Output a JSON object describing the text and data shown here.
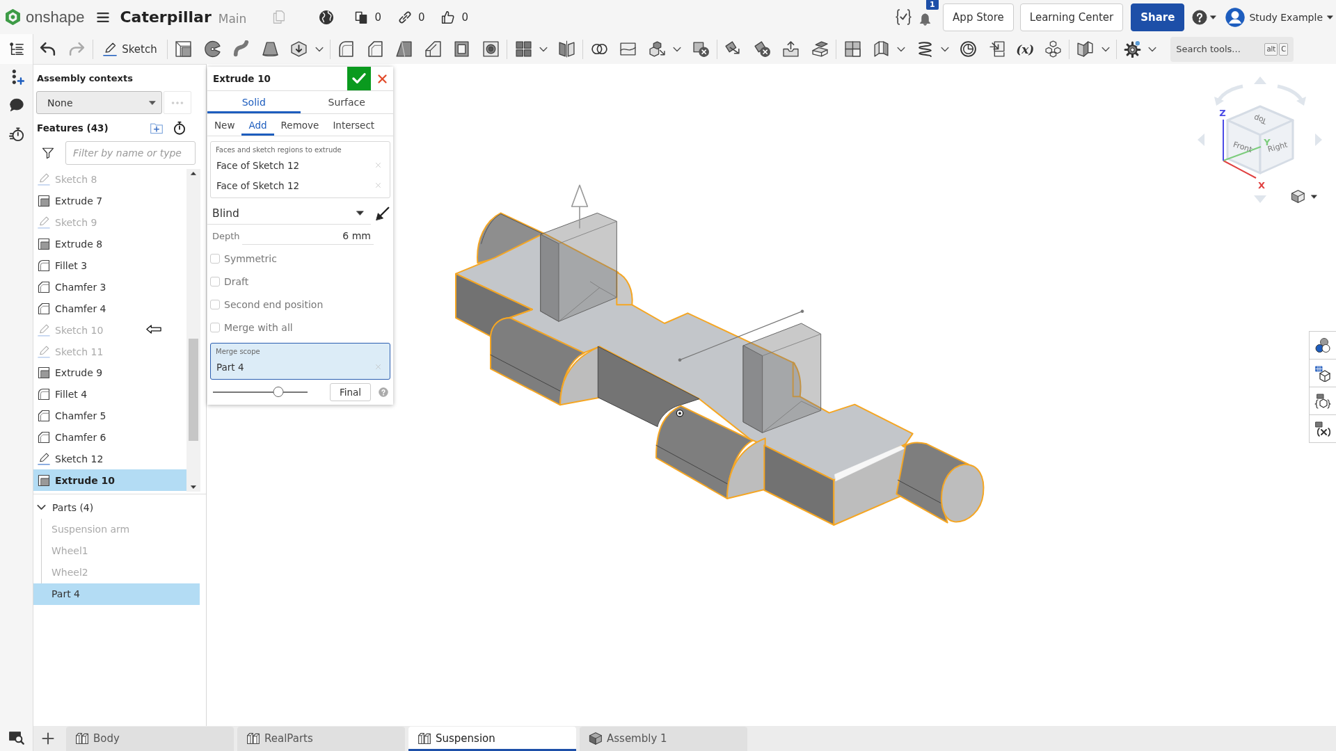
{
  "top_bar": {
    "logo_text": "onshape",
    "document_title": "Caterpillar",
    "workspace": "Main",
    "counters": [
      {
        "kind": "versions",
        "value": "0"
      },
      {
        "kind": "links",
        "value": "0"
      },
      {
        "kind": "likes",
        "value": "0"
      }
    ],
    "notifications": "1",
    "buttons": [
      {
        "label": "App Store",
        "kind": "outline"
      },
      {
        "label": "Learning Center",
        "kind": "outline"
      },
      {
        "label": "Share",
        "kind": "primary"
      }
    ],
    "user_name": "Study Example"
  },
  "toolbar": {
    "sketch_label": "Sketch",
    "variable_label": "(x)",
    "search": {
      "placeholder": "Search tools...",
      "keys": [
        "alt",
        "C"
      ]
    }
  },
  "left_panel": {
    "assembly_contexts": {
      "title": "Assembly contexts",
      "value": "None"
    },
    "features": {
      "title": "Features (43)",
      "filter_placeholder": "Filter by name or type",
      "items": [
        {
          "name": "Sketch 8",
          "kind": "sketch",
          "hidden": true,
          "selected": false
        },
        {
          "name": "Extrude 7",
          "kind": "extrude",
          "hidden": false,
          "selected": false
        },
        {
          "name": "Sketch 9",
          "kind": "sketch",
          "hidden": true,
          "selected": false
        },
        {
          "name": "Extrude 8",
          "kind": "extrude",
          "hidden": false,
          "selected": false
        },
        {
          "name": "Fillet 3",
          "kind": "fillet",
          "hidden": false,
          "selected": false
        },
        {
          "name": "Chamfer 3",
          "kind": "chamfer",
          "hidden": false,
          "selected": false
        },
        {
          "name": "Chamfer 4",
          "kind": "chamfer",
          "hidden": false,
          "selected": false
        },
        {
          "name": "Sketch 10",
          "kind": "sketch",
          "hidden": true,
          "selected": false
        },
        {
          "name": "Sketch 11",
          "kind": "sketch",
          "hidden": true,
          "selected": false
        },
        {
          "name": "Extrude 9",
          "kind": "extrude",
          "hidden": false,
          "selected": false
        },
        {
          "name": "Fillet 4",
          "kind": "fillet",
          "hidden": false,
          "selected": false
        },
        {
          "name": "Chamfer 5",
          "kind": "chamfer",
          "hidden": false,
          "selected": false
        },
        {
          "name": "Chamfer 6",
          "kind": "chamfer",
          "hidden": false,
          "selected": false
        },
        {
          "name": "Sketch 12",
          "kind": "sketch",
          "hidden": false,
          "selected": false
        },
        {
          "name": "Extrude 10",
          "kind": "extrude",
          "hidden": false,
          "selected": true
        }
      ]
    },
    "parts": {
      "title": "Parts (4)",
      "expanded": true,
      "children": [
        {
          "name": "Suspension arm",
          "hidden": true,
          "selected": false
        },
        {
          "name": "Wheel1",
          "hidden": true,
          "selected": false
        },
        {
          "name": "Wheel2",
          "hidden": true,
          "selected": false
        },
        {
          "name": "Part 4",
          "hidden": false,
          "selected": true
        }
      ]
    }
  },
  "feature_dialog": {
    "title": "Extrude 10",
    "body_tabs": [
      {
        "label": "Solid",
        "selected": true
      },
      {
        "label": "Surface",
        "selected": false
      }
    ],
    "operation_tabs": [
      {
        "label": "New",
        "selected": false
      },
      {
        "label": "Add",
        "selected": true
      },
      {
        "label": "Remove",
        "selected": false
      },
      {
        "label": "Intersect",
        "selected": false
      }
    ],
    "selection": {
      "label": "Faces and sketch regions to extrude",
      "items": [
        "Face of Sketch 12",
        "Face of Sketch 12"
      ]
    },
    "end_type": "Blind",
    "depth": {
      "label": "Depth",
      "value": "6 mm"
    },
    "options": [
      {
        "label": "Symmetric",
        "checked": false
      },
      {
        "label": "Draft",
        "checked": false
      },
      {
        "label": "Second end position",
        "checked": false
      },
      {
        "label": "Merge with all",
        "checked": false
      }
    ],
    "merge_scope": {
      "label": "Merge scope",
      "items": [
        "Part 4"
      ],
      "focused": true
    },
    "rollback_slider": {
      "level": 0.69
    },
    "final_button": "Final"
  },
  "view_cube": {
    "faces": [
      {
        "label": "Top",
        "kind": "top"
      },
      {
        "label": "Front",
        "kind": "front"
      },
      {
        "label": "Right",
        "kind": "right"
      }
    ],
    "axes": [
      {
        "label": "X",
        "kind": "x",
        "color": "#e04040"
      },
      {
        "label": "Y",
        "kind": "y",
        "color": "#7ccc7c"
      },
      {
        "label": "Z",
        "kind": "z",
        "color": "#4b4be6"
      }
    ]
  },
  "tabs": [
    {
      "label": "Body",
      "kind": "part_studio",
      "selected": false
    },
    {
      "label": "RealParts",
      "kind": "part_studio",
      "selected": false
    },
    {
      "label": "Suspension",
      "kind": "part_studio",
      "selected": true
    },
    {
      "label": "Assembly 1",
      "kind": "assembly",
      "selected": false
    }
  ]
}
